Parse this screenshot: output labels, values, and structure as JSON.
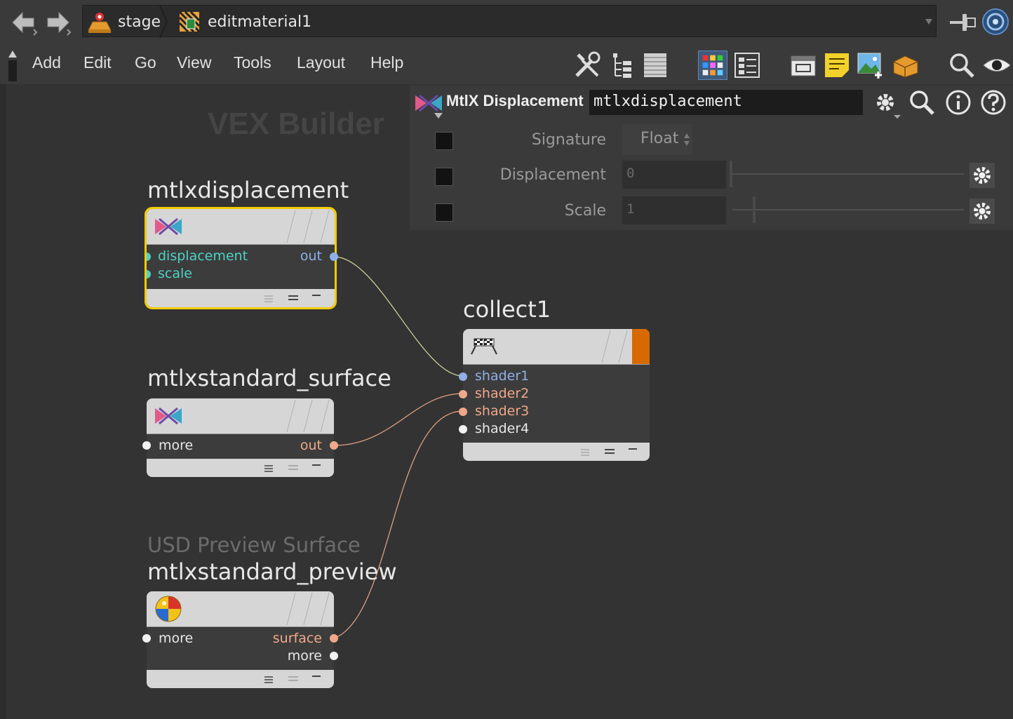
{
  "path": {
    "crumbs": [
      "stage",
      "editmaterial1"
    ]
  },
  "menu": {
    "items": [
      "Add",
      "Edit",
      "Go",
      "View",
      "Tools",
      "Layout",
      "Help"
    ]
  },
  "network": {
    "context_title": "VEX Builder",
    "nodes": {
      "disp": {
        "name": "mtlxdisplacement",
        "inputs": [
          "displacement",
          "scale"
        ],
        "output": "out"
      },
      "surf": {
        "name": "mtlxstandard_surface",
        "input": "more",
        "output": "out"
      },
      "preview": {
        "subtitle": "USD Preview Surface",
        "name": "mtlxstandard_preview",
        "input": "more",
        "outputs": [
          "surface",
          "more"
        ]
      },
      "collect": {
        "name": "collect1",
        "inputs": [
          "shader1",
          "shader2",
          "shader3",
          "shader4"
        ]
      }
    }
  },
  "params": {
    "node_type": "MtlX Displacement",
    "node_name": "mtlxdisplacement",
    "signature_label": "Signature",
    "signature_value": "Float",
    "displacement_label": "Displacement",
    "displacement_value": "0",
    "scale_label": "Scale",
    "scale_value": "1"
  },
  "colors": {
    "background": "#333333",
    "selected_outline": "#f2cc00",
    "port_teal": "#4fd1c5",
    "port_blue": "#8fb0e6",
    "port_orange": "#f0a88a",
    "collect_flag": "#d66a00"
  }
}
